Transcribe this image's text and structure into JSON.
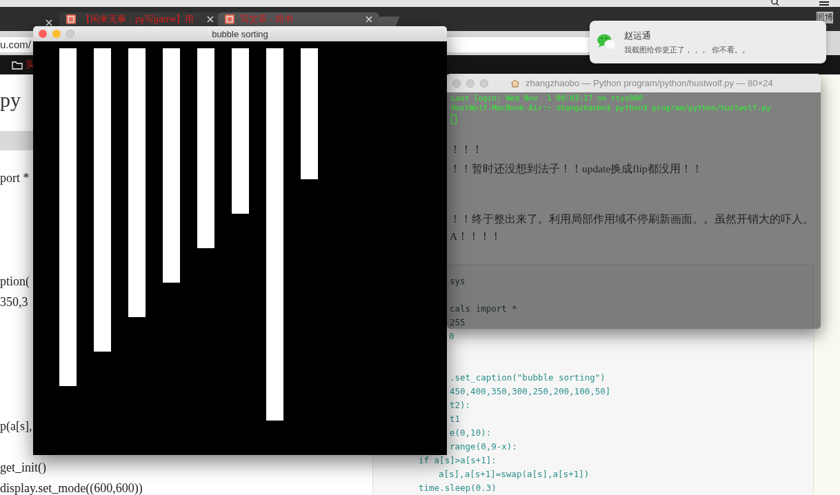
{
  "browser": {
    "tabs": [
      {
        "label": "【闲来无事，py写game】用",
        "selected": false
      },
      {
        "label": "写文章 - 简书",
        "selected": true
      }
    ],
    "address": "u.com/",
    "bookmark": "实",
    "bookmark_right": "照博"
  },
  "article_left": {
    "heading": "py",
    "lines": [
      "port *",
      "ption(",
      "350,3",
      "p(a[s],",
      "get_init()",
      "display.set_mode((600,600))"
    ]
  },
  "article_right": {
    "paragraphs": [
      "！！！",
      "！！暂时还没想到法子！！update换成flip都没用！！",
      "！！终于整出来了。利用局部作用域不停刷新画面。。虽然开销大的吓人。",
      "A！！！！"
    ],
    "code": [
      "sys",
      "cals import *",
      "255",
      "0",
      ".set_caption(\"bubble sorting\")",
      "450,400,350,300,250,200,100,50]",
      "t2):",
      "t1",
      "e(0,10):",
      "range(0,9-x):",
      "if a[s]>a[s+1]:",
      "a[s],a[s+1]=swap(a[s],a[s+1])",
      "time.sleep(0.3)"
    ]
  },
  "game_window": {
    "title": "bubble sorting"
  },
  "terminal": {
    "title": "zhangzhaobo — Python program/python/hustwolf.py — 80×24",
    "lines": [
      "Last login: Wed Nov  1 00:03:17 on ttys000",
      "HustWolf-MacBook-Air:~ zhangzhaobo$ python3 program/python/hustwolf.py"
    ]
  },
  "notification": {
    "sender": "赵运通",
    "message": "我截图给你更正了，，，  你不看。。"
  }
}
